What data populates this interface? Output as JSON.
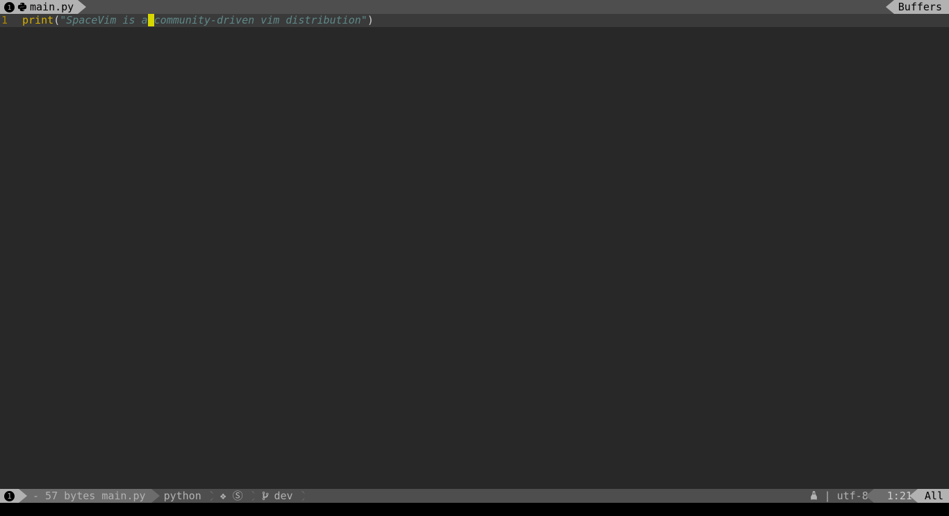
{
  "tabbar": {
    "tab_number": "1",
    "filename": "main.py",
    "buffers_label": "Buffers"
  },
  "code": {
    "line_number": "1",
    "func": "print",
    "paren_open": "(",
    "str_before_cursor": "\"SpaceVim is a",
    "cursor_char": " ",
    "str_after_cursor": "community-driven vim distribution\"",
    "paren_close": ")"
  },
  "status": {
    "mode_window": "1",
    "file_info": "- 57 bytes main.py",
    "filetype": "python",
    "syntastic": "❖ Ⓢ",
    "git_branch": "dev",
    "os_sep": " | ",
    "encoding": "utf-8",
    "position": " 1:21",
    "percent": "All"
  }
}
